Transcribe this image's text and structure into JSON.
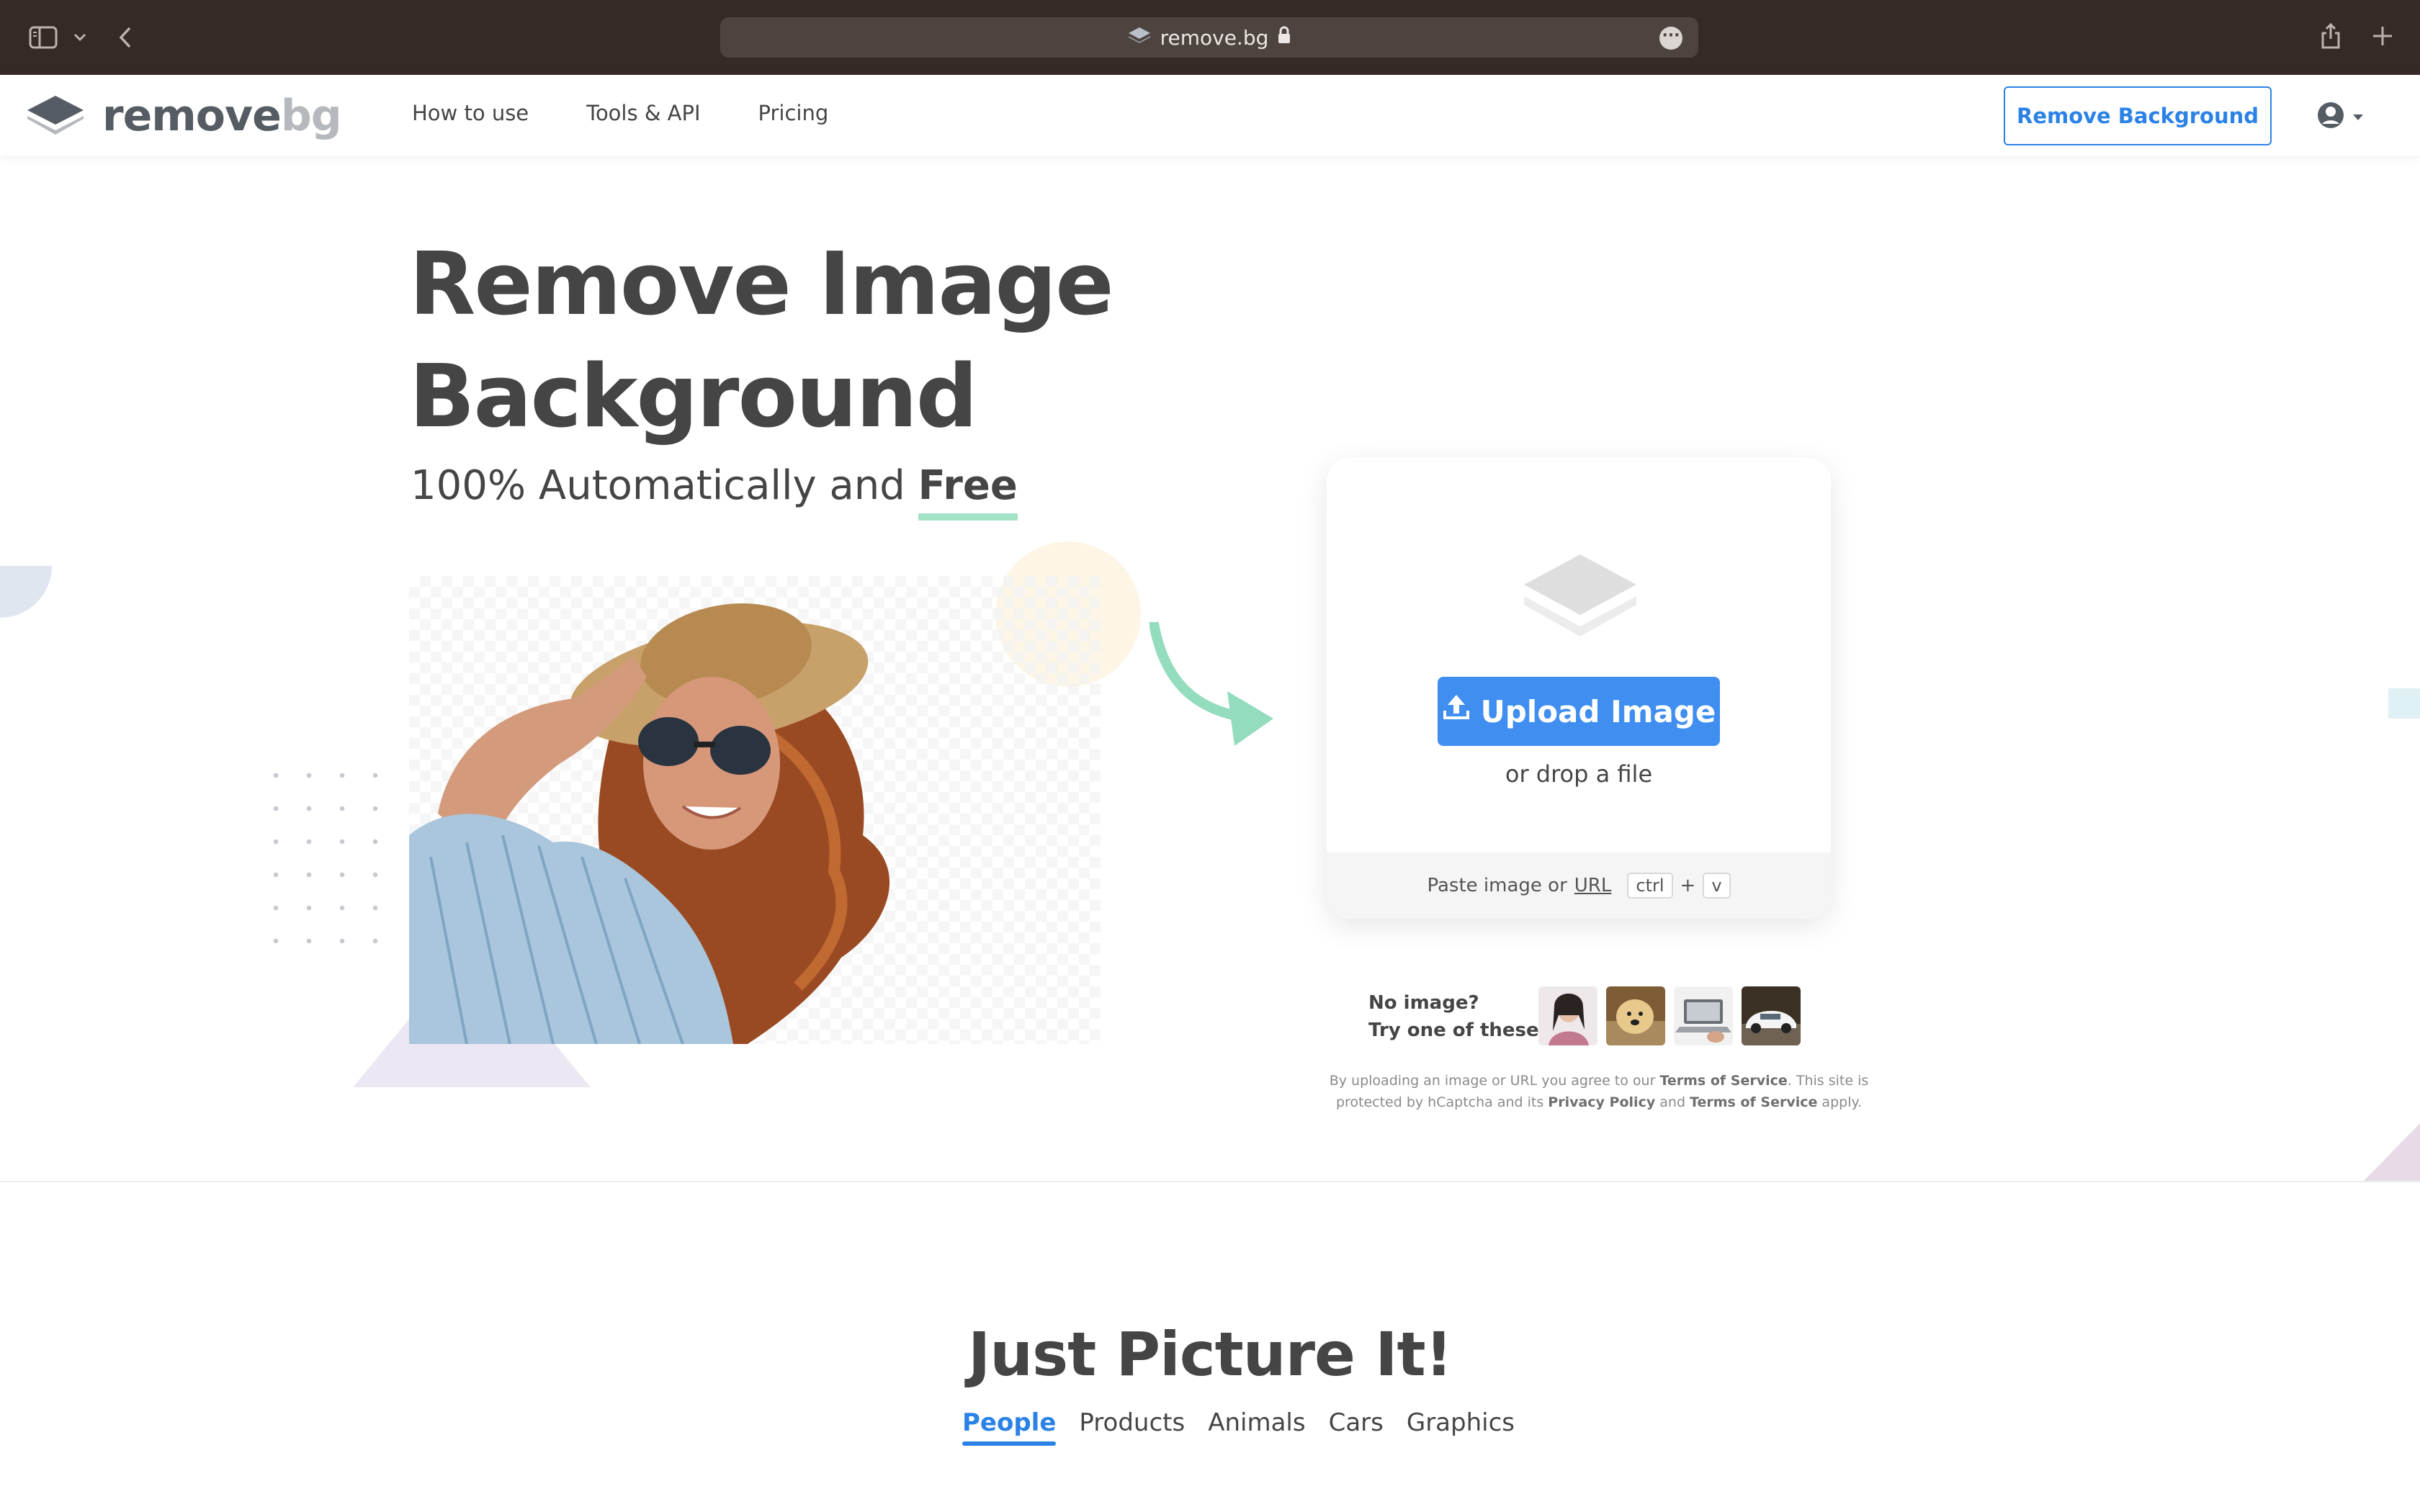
{
  "browser": {
    "url": "remove.bg"
  },
  "nav": {
    "logo_part1": "remove",
    "logo_part2": "bg",
    "links": [
      "How to use",
      "Tools & API",
      "Pricing"
    ],
    "cta": "Remove Background"
  },
  "hero": {
    "title_line1": "Remove Image",
    "title_line2": "Background",
    "subtitle_prefix": "100% Automatically and ",
    "subtitle_emphasis": "Free"
  },
  "upload": {
    "button": "Upload Image",
    "drop_text": "or drop a file",
    "paste_prefix": "Paste image or ",
    "paste_url": "URL",
    "key_ctrl": "ctrl",
    "key_plus": "+",
    "key_v": "v"
  },
  "samples": {
    "line1": "No image?",
    "line2": "Try one of these:"
  },
  "legal": {
    "t1": "By uploading an image or URL you agree to our ",
    "terms1": "Terms of Service",
    "t2": ". This site is protected by hCaptcha and its ",
    "privacy": "Privacy Policy",
    "t3": " and ",
    "terms2": "Terms of Service",
    "t4": " apply."
  },
  "section": {
    "title": "Just Picture It!",
    "tabs": [
      "People",
      "Products",
      "Animals",
      "Cars",
      "Graphics"
    ]
  },
  "colors": {
    "accent": "#2b82e6",
    "button": "#3f8ef0",
    "text": "#454545",
    "chrome": "#352a26"
  }
}
